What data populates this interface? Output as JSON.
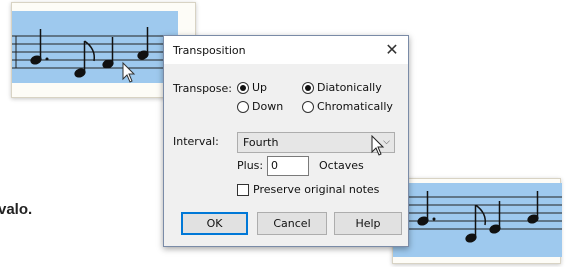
{
  "page": {
    "body_text": "valo."
  },
  "dialog": {
    "title": "Transposition",
    "close_glyph": "✕",
    "transpose_label": "Transpose:",
    "direction_options": [
      {
        "label": "Up",
        "selected": true
      },
      {
        "label": "Down",
        "selected": false
      }
    ],
    "mode_options": [
      {
        "label": "Diatonically",
        "selected": true
      },
      {
        "label": "Chromatically",
        "selected": false
      }
    ],
    "interval_label": "Interval:",
    "interval_value": "Fourth",
    "interval_arrow": "⌵",
    "plus_label": "Plus:",
    "plus_value": "0",
    "octaves_label": "Octaves",
    "preserve_label": "Preserve original notes",
    "preserve_checked": false,
    "ok_label": "OK",
    "cancel_label": "Cancel",
    "help_label": "Help"
  },
  "colors": {
    "staff_highlight": "#9ec9ee",
    "accent": "#0078d7"
  },
  "icons": [
    "close-icon",
    "dropdown-arrow-icon",
    "mouse-cursor-icon",
    "note-icon"
  ]
}
